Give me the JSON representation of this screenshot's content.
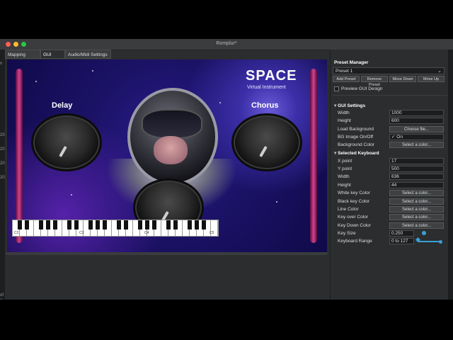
{
  "window": {
    "title": "Romplur*"
  },
  "left_trim": {
    "lines": [
      "n",
      "20",
      "20",
      "20",
      "20",
      "of",
      "lo"
    ]
  },
  "tabs": [
    {
      "label": "Mapping Editor"
    },
    {
      "label": "GUI Editor"
    },
    {
      "label": "Audio/Midi Settings"
    }
  ],
  "canvas": {
    "brand_title": "SPACE",
    "brand_subtitle": "Virtual Instrument",
    "delay_label": "Delay",
    "chorus_label": "Chorus",
    "keyboard": {
      "octave_labels": [
        "C2",
        "C3",
        "C4",
        "C5"
      ]
    }
  },
  "preset_manager": {
    "title": "Preset Manager",
    "selected_preset": "Preset 1",
    "buttons": {
      "add": "Add Preset",
      "remove": "Remove Preset",
      "down": "Move Down",
      "up": "Move Up"
    },
    "preview_label": "Preview GUI Design"
  },
  "gui_settings": {
    "title": "GUI Settings",
    "width_label": "Width",
    "width_value": "1000",
    "height_label": "Height",
    "height_value": "600",
    "load_bg_label": "Load Background",
    "load_bg_button": "Choose file...",
    "bg_onoff_label": "BG Image On/Off",
    "bg_onoff_value": "On",
    "bg_color_label": "Background Color",
    "bg_color_button": "Select a color..."
  },
  "selected_keyboard": {
    "title": "Selected Keyboard",
    "x_label": "X point",
    "x_value": "17",
    "y_label": "Y point",
    "y_value": "500",
    "width_label": "Width",
    "width_value": "636",
    "height_label": "Height",
    "height_value": "44",
    "white_key_label": "White key Color",
    "black_key_label": "Black key Color",
    "line_label": "Line Color",
    "key_over_label": "Key over Color",
    "key_down_label": "Key Down Color",
    "select_color": "Select a color...",
    "key_size_label": "Key Size",
    "key_size_value": "0.250",
    "key_range_label": "Keyboard Range",
    "key_range_value": "0 to 127"
  },
  "colors": {
    "accent": "#3aa0d8",
    "canvas_bg": "#1b1266",
    "bar": "#d2428f"
  }
}
